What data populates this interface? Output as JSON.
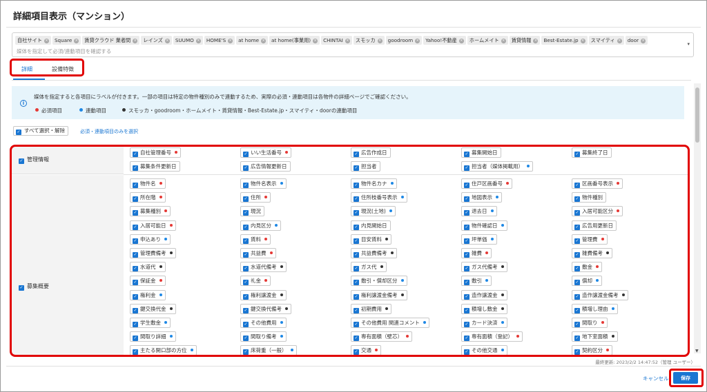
{
  "title": "詳細項目表示（マンション）",
  "media": {
    "chips": [
      "自社サイト",
      "Square",
      "賃貸クラウド 業者間",
      "レインズ",
      "SUUMO",
      "HOME'S",
      "at home",
      "at home(事業用)",
      "CHINTAI",
      "スモッカ",
      "goodroom",
      "Yahoo!不動産",
      "ホームメイト",
      "賃貸情報",
      "Best-Estate.jp",
      "スマイティ",
      "door"
    ],
    "placeholder": "媒体を指定して必須/連動項目を確認する",
    "remove_glyph": "×",
    "caret": "▾"
  },
  "tabs": {
    "detail": "詳細",
    "equipment": "設備特徴"
  },
  "info": {
    "icon": "i",
    "text": "媒体を指定すると各項目にラベルが付きます。一部の項目は特定の物件種別のみで連動するため、実際の必須・連動項目は各物件の詳細ページでご確認ください。",
    "legend": {
      "required": "必須項目",
      "linked": "連動項目",
      "special": "スモッカ・goodroom・ホームメイト・賃貸情報・Best-Estate.jp・スマイティ・doorの連動項目"
    },
    "colors": {
      "required": "#e53935",
      "linked": "#1e88e5",
      "special": "#333333"
    }
  },
  "select_all": "すべて選択・解除",
  "required_only": "必須・連動項目のみを選択",
  "check_glyph": "✓",
  "categories": {
    "management": {
      "label": "管理情報",
      "items": [
        {
          "label": "自社管理番号",
          "mark": "r"
        },
        {
          "label": "いい生活番号",
          "mark": "r"
        },
        {
          "label": "広告作成日",
          "mark": ""
        },
        {
          "label": "募集開始日",
          "mark": ""
        },
        {
          "label": "募集終了日",
          "mark": ""
        },
        {
          "label": "募集条件更新日",
          "mark": ""
        },
        {
          "label": "広告情報更新日",
          "mark": ""
        },
        {
          "label": "担当者",
          "mark": ""
        },
        {
          "label": "担当者（媒体掲載用）",
          "mark": "b"
        }
      ]
    },
    "recruitment": {
      "label": "募集概要",
      "items": [
        {
          "label": "物件名",
          "mark": "r"
        },
        {
          "label": "物件名表示",
          "mark": "b"
        },
        {
          "label": "物件名カナ",
          "mark": "b"
        },
        {
          "label": "住戸区画番号",
          "mark": "r"
        },
        {
          "label": "区画番号表示",
          "mark": "r"
        },
        {
          "label": "所在階",
          "mark": "r"
        },
        {
          "label": "住所",
          "mark": "r"
        },
        {
          "label": "住所枝番号表示",
          "mark": "b"
        },
        {
          "label": "地図表示",
          "mark": "b"
        },
        {
          "label": "物件種別",
          "mark": ""
        },
        {
          "label": "募集種別",
          "mark": "r"
        },
        {
          "label": "現況",
          "mark": ""
        },
        {
          "label": "現況(土地)",
          "mark": "b"
        },
        {
          "label": "退去日",
          "mark": "b"
        },
        {
          "label": "入居可能区分",
          "mark": "r"
        },
        {
          "label": "入居可能日",
          "mark": "r"
        },
        {
          "label": "内見区分",
          "mark": "b"
        },
        {
          "label": "内見開始日",
          "mark": ""
        },
        {
          "label": "物件確認日",
          "mark": "b"
        },
        {
          "label": "広告用更新日",
          "mark": ""
        },
        {
          "label": "申込あり",
          "mark": "b"
        },
        {
          "label": "賃料",
          "mark": "r"
        },
        {
          "label": "目安賃料",
          "mark": "k"
        },
        {
          "label": "坪単価",
          "mark": "b"
        },
        {
          "label": "管理費",
          "mark": "r"
        },
        {
          "label": "管理費備考",
          "mark": "k"
        },
        {
          "label": "共益費",
          "mark": "r"
        },
        {
          "label": "共益費備考",
          "mark": "k"
        },
        {
          "label": "雑費",
          "mark": "r"
        },
        {
          "label": "雑費備考",
          "mark": "k"
        },
        {
          "label": "水道代",
          "mark": "k"
        },
        {
          "label": "水道代備考",
          "mark": "k"
        },
        {
          "label": "ガス代",
          "mark": "k"
        },
        {
          "label": "ガス代備考",
          "mark": "k"
        },
        {
          "label": "敷金",
          "mark": "r"
        },
        {
          "label": "保証金",
          "mark": "r"
        },
        {
          "label": "礼金",
          "mark": "r"
        },
        {
          "label": "敷引・償却区分",
          "mark": "b"
        },
        {
          "label": "敷引",
          "mark": "b"
        },
        {
          "label": "償却",
          "mark": "b"
        },
        {
          "label": "権利金",
          "mark": "b"
        },
        {
          "label": "権利譲渡金",
          "mark": "k"
        },
        {
          "label": "権利譲渡金備考",
          "mark": "k"
        },
        {
          "label": "造作譲渡金",
          "mark": "k"
        },
        {
          "label": "造作譲渡金備考",
          "mark": "k"
        },
        {
          "label": "鍵交換代金",
          "mark": "k"
        },
        {
          "label": "鍵交換代備考",
          "mark": "k"
        },
        {
          "label": "初期費用",
          "mark": "k"
        },
        {
          "label": "積増し敷金",
          "mark": "k"
        },
        {
          "label": "積増し理由",
          "mark": "b"
        },
        {
          "label": "学生敷金",
          "mark": "b"
        },
        {
          "label": "その他費用",
          "mark": "b"
        },
        {
          "label": "その他費用 関連コメント",
          "mark": "b"
        },
        {
          "label": "カード決済",
          "mark": "b"
        },
        {
          "label": "間取り",
          "mark": "r"
        },
        {
          "label": "間取り詳細",
          "mark": "b"
        },
        {
          "label": "間取り備考",
          "mark": "b"
        },
        {
          "label": "専有面積（壁芯）",
          "mark": "r"
        },
        {
          "label": "専有面積（登記）",
          "mark": "r"
        },
        {
          "label": "地下室面積",
          "mark": "k"
        },
        {
          "label": "主たる開口部の方位",
          "mark": "b"
        },
        {
          "label": "床荷重（一般）",
          "mark": "b"
        },
        {
          "label": "交通",
          "mark": "r"
        },
        {
          "label": "その他交通",
          "mark": "b"
        },
        {
          "label": "契約区分",
          "mark": "r"
        }
      ]
    }
  },
  "last_updated": "最終更新: 2023/2/2 14:47:52（管理 ユーザー）",
  "footer": {
    "cancel": "キャンセル",
    "save": "保存"
  },
  "scroll_down_glyph": "▼"
}
